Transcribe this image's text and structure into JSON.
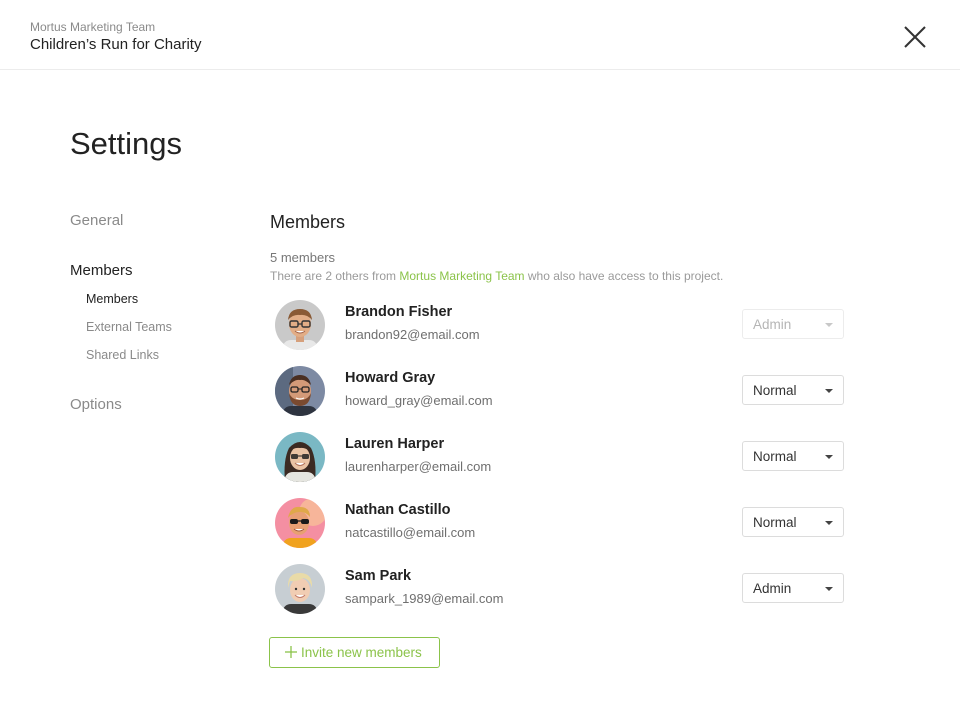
{
  "header": {
    "team_name": "Mortus Marketing Team",
    "project_name": "Children’s Run for Charity",
    "close_icon": "close-icon"
  },
  "page_title": "Settings",
  "nav": {
    "general": "General",
    "members": "Members",
    "members_sub": [
      "Members",
      "External Teams",
      "Shared Links"
    ],
    "options": "Options",
    "active_sub": "Members"
  },
  "members_section": {
    "title": "Members",
    "count_text": "5 members",
    "note_prefix": "There are 2 others from ",
    "note_team": "Mortus Marketing Team",
    "note_suffix": " who also have access to this project.",
    "team_link_color": "#8bc34a"
  },
  "members": [
    {
      "name": "Brandon Fisher",
      "email": "brandon92@email.com",
      "role": "Admin"
    },
    {
      "name": "Howard Gray",
      "email": "howard_gray@email.com",
      "role": "Normal"
    },
    {
      "name": "Lauren Harper",
      "email": "laurenharper@email.com",
      "role": "Normal"
    },
    {
      "name": "Nathan Castillo",
      "email": "natcastillo@email.com",
      "role": "Normal"
    },
    {
      "name": "Sam Park",
      "email": "sampark_1989@email.com",
      "role": "Admin"
    }
  ],
  "invite": {
    "label": "Invite new members",
    "icon": "plus-icon",
    "accent": "#8bc34a"
  }
}
